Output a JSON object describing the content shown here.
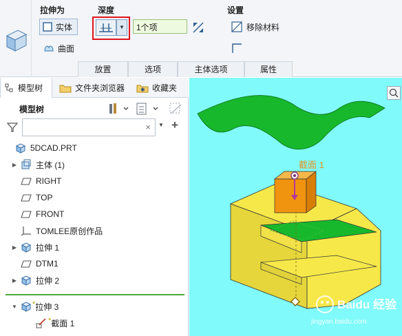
{
  "ribbon": {
    "extrude_as": {
      "title": "拉伸为",
      "solid_label": "实体",
      "surface_label": "曲面"
    },
    "depth": {
      "title": "深度",
      "value": "1个项"
    },
    "settings": {
      "title": "设置",
      "remove_material_label": "移除材料"
    },
    "tabs": [
      "放置",
      "选项",
      "主体选项",
      "属性"
    ]
  },
  "panel": {
    "tabs": [
      "模型树",
      "文件夹浏览器",
      "收藏夹"
    ],
    "tree_header": "模型树",
    "filter_clear": "×",
    "filter_add": "+",
    "items": [
      {
        "label": "5DCAD.PRT",
        "icon": "part-icon",
        "expandable": false
      },
      {
        "label": "主体 (1)",
        "icon": "body-icon",
        "expandable": true
      },
      {
        "label": "RIGHT",
        "icon": "datum-plane-icon",
        "expandable": false
      },
      {
        "label": "TOP",
        "icon": "datum-plane-icon",
        "expandable": false
      },
      {
        "label": "FRONT",
        "icon": "datum-plane-icon",
        "expandable": false
      },
      {
        "label": "TOMLEE原创作品",
        "icon": "csys-icon",
        "expandable": false
      },
      {
        "label": "拉伸 1",
        "icon": "extrude-icon",
        "expandable": true
      },
      {
        "label": "DTM1",
        "icon": "datum-plane-icon",
        "expandable": false
      },
      {
        "label": "拉伸 2",
        "icon": "extrude-icon",
        "expandable": true
      }
    ],
    "active_items": [
      {
        "label": "拉伸 3",
        "icon": "extrude-icon",
        "expandable": true,
        "expanded": true
      },
      {
        "label": "截面 1",
        "icon": "sketch-icon",
        "expandable": false
      }
    ],
    "new_marker": "*"
  },
  "viewport": {
    "section_label": "截面 1",
    "background": "#80fafa",
    "watermark": {
      "text": "Baidu 经验",
      "url": "jingyan.baidu.com"
    }
  },
  "colors": {
    "highlight_box": "#e0131b",
    "green_separator": "#4aa832",
    "surface_green": "#17b82c",
    "part_yellow": "#f7e84a",
    "section_orange": "#f0930e"
  }
}
